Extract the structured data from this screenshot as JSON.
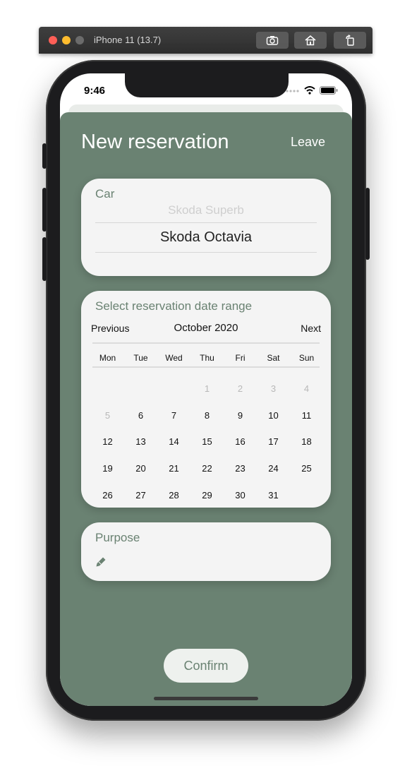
{
  "simulator": {
    "title": "iPhone 11 (13.7)"
  },
  "status": {
    "time": "9:46"
  },
  "header": {
    "title": "New reservation",
    "leave_label": "Leave"
  },
  "car": {
    "title": "Car",
    "above_option": "Skoda Superb",
    "selected": "Skoda Octavia"
  },
  "calendar": {
    "title": "Select reservation date range",
    "prev_label": "Previous",
    "next_label": "Next",
    "month_label": "October 2020",
    "weekdays": [
      "Mon",
      "Tue",
      "Wed",
      "Thu",
      "Fri",
      "Sat",
      "Sun"
    ],
    "weeks": [
      [
        "",
        "",
        "",
        "1",
        "2",
        "3",
        "4"
      ],
      [
        "5",
        "6",
        "7",
        "8",
        "9",
        "10",
        "11"
      ],
      [
        "12",
        "13",
        "14",
        "15",
        "16",
        "17",
        "18"
      ],
      [
        "19",
        "20",
        "21",
        "22",
        "23",
        "24",
        "25"
      ],
      [
        "26",
        "27",
        "28",
        "29",
        "30",
        "31",
        ""
      ]
    ],
    "disabled_days": [
      "1",
      "2",
      "3",
      "4",
      "5"
    ]
  },
  "purpose": {
    "title": "Purpose",
    "icon": "pencil-icon"
  },
  "confirm_label": "Confirm",
  "colors": {
    "accent": "#6a8272",
    "card": "#f4f4f4",
    "confirm_bg": "#eef1ee"
  }
}
